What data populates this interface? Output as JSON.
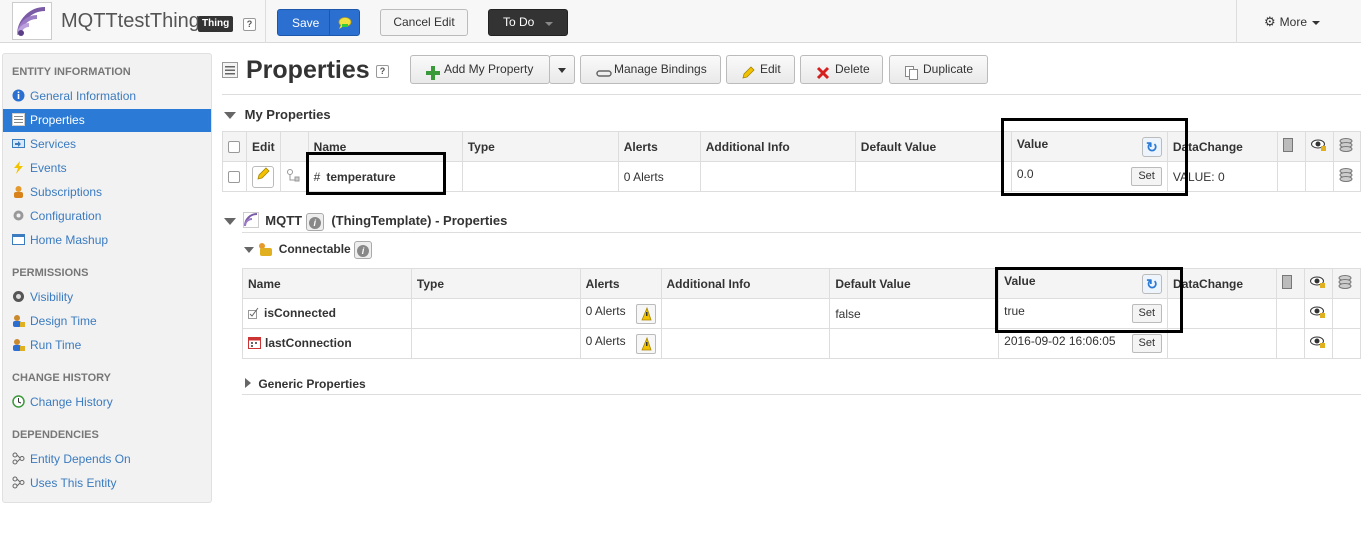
{
  "header": {
    "thing_name": "MQTTtestThing",
    "badge": "Thing",
    "help": "?",
    "save_label": "Save",
    "cancel_label": "Cancel Edit",
    "todo_label": "To Do",
    "more_label": "More"
  },
  "sidebar": {
    "sections": [
      {
        "title": "ENTITY INFORMATION"
      },
      {
        "title": "PERMISSIONS"
      },
      {
        "title": "CHANGE HISTORY"
      },
      {
        "title": "DEPENDENCIES"
      }
    ],
    "items": [
      {
        "label": "General Information",
        "icon": "info-icon"
      },
      {
        "label": "Properties",
        "icon": "properties-icon",
        "active": true
      },
      {
        "label": "Services",
        "icon": "services-icon"
      },
      {
        "label": "Events",
        "icon": "lightning-icon"
      },
      {
        "label": "Subscriptions",
        "icon": "subscriptions-icon"
      },
      {
        "label": "Configuration",
        "icon": "gear-icon"
      },
      {
        "label": "Home Mashup",
        "icon": "mashup-icon"
      },
      {
        "label": "Visibility",
        "icon": "visibility-icon"
      },
      {
        "label": "Design Time",
        "icon": "user-lock-icon"
      },
      {
        "label": "Run Time",
        "icon": "user-lock-icon"
      },
      {
        "label": "Change History",
        "icon": "history-icon"
      },
      {
        "label": "Entity Depends On",
        "icon": "dependency-icon"
      },
      {
        "label": "Uses This Entity",
        "icon": "dependency-icon"
      }
    ]
  },
  "main": {
    "title": "Properties",
    "help": "?",
    "toolbar": {
      "add_property": "Add My Property",
      "manage_bindings": "Manage Bindings",
      "edit": "Edit",
      "delete": "Delete",
      "duplicate": "Duplicate"
    },
    "my_properties": {
      "title": "My Properties",
      "columns": [
        "Edit",
        "Name",
        "Type",
        "Alerts",
        "Additional Info",
        "Default Value",
        "Value",
        "DataChange"
      ],
      "rows": [
        {
          "name": "temperature",
          "type_glyph": "#",
          "type": "",
          "alerts": "0 Alerts",
          "additional_info": "",
          "default_value": "",
          "value": "0.0",
          "set": "Set",
          "datachange": "VALUE: 0"
        }
      ]
    },
    "template": {
      "title_prefix": "MQTT",
      "title_suffix": "(ThingTemplate) - Properties",
      "shape": {
        "title": "Connectable",
        "columns": [
          "Name",
          "Type",
          "Alerts",
          "Additional Info",
          "Default Value",
          "Value",
          "DataChange"
        ],
        "rows": [
          {
            "name": "isConnected",
            "icon": "boolean-icon",
            "type": "",
            "alerts": "0 Alerts",
            "additional_info": "",
            "default_value": "false",
            "value": "true",
            "set": "Set",
            "datachange": ""
          },
          {
            "name": "lastConnection",
            "icon": "datetime-icon",
            "type": "",
            "alerts": "0 Alerts",
            "additional_info": "",
            "default_value": "",
            "value": "2016-09-02 16:06:05",
            "set": "Set",
            "datachange": ""
          }
        ]
      },
      "generic": {
        "title": "Generic Properties"
      }
    }
  },
  "colors": {
    "accent": "#2b7bd6",
    "save_button": "#2b6fd0",
    "todo_button": "#333333",
    "highlight_box": "#000000"
  }
}
